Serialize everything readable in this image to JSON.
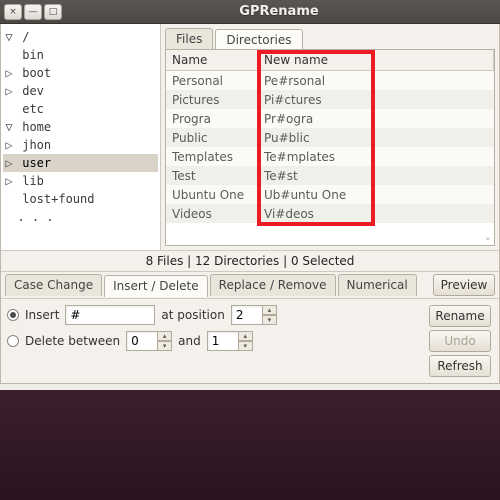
{
  "window": {
    "title": "GPRename",
    "btn_min": "—",
    "btn_max": "□",
    "btn_close": "×"
  },
  "tree": {
    "items": [
      {
        "indent": 0,
        "twisty": "▽",
        "label": "/",
        "sel": false
      },
      {
        "indent": 1,
        "twisty": "",
        "label": "bin",
        "sel": false
      },
      {
        "indent": 1,
        "twisty": "▷",
        "label": "boot",
        "sel": false
      },
      {
        "indent": 1,
        "twisty": "▷",
        "label": "dev",
        "sel": false
      },
      {
        "indent": 1,
        "twisty": "",
        "label": "etc",
        "sel": false
      },
      {
        "indent": 1,
        "twisty": "▽",
        "label": "home",
        "sel": false
      },
      {
        "indent": 2,
        "twisty": "▷",
        "label": "jhon",
        "sel": false
      },
      {
        "indent": 2,
        "twisty": "▷",
        "label": "user",
        "sel": true
      },
      {
        "indent": 1,
        "twisty": "▷",
        "label": "lib",
        "sel": false
      },
      {
        "indent": 1,
        "twisty": "",
        "label": "lost+found",
        "sel": false
      }
    ]
  },
  "list_tabs": {
    "files": "Files",
    "directories": "Directories"
  },
  "columns": {
    "name": "Name",
    "newname": "New name"
  },
  "rows": [
    {
      "name": "Personal",
      "newname": "Pe#rsonal"
    },
    {
      "name": "Pictures",
      "newname": "Pi#ctures"
    },
    {
      "name": "Progra",
      "newname": "Pr#ogra"
    },
    {
      "name": "Public",
      "newname": "Pu#blic"
    },
    {
      "name": "Templates",
      "newname": "Te#mplates"
    },
    {
      "name": "Test",
      "newname": "Te#st"
    },
    {
      "name": "Ubuntu One",
      "newname": "Ub#untu One"
    },
    {
      "name": "Videos",
      "newname": "Vi#deos"
    }
  ],
  "status": "8 Files | 12 Directories | 0 Selected",
  "ops_tabs": {
    "case": "Case Change",
    "insdel": "Insert / Delete",
    "reprem": "Replace / Remove",
    "num": "Numerical"
  },
  "form": {
    "insert_label": "Insert",
    "insert_value": "#",
    "at_position_label": "at position",
    "at_position_value": "2",
    "delete_label": "Delete between",
    "delete_from": "0",
    "and_label": "and",
    "delete_to": "1"
  },
  "buttons": {
    "preview": "Preview",
    "rename": "Rename",
    "undo": "Undo",
    "refresh": "Refresh"
  }
}
